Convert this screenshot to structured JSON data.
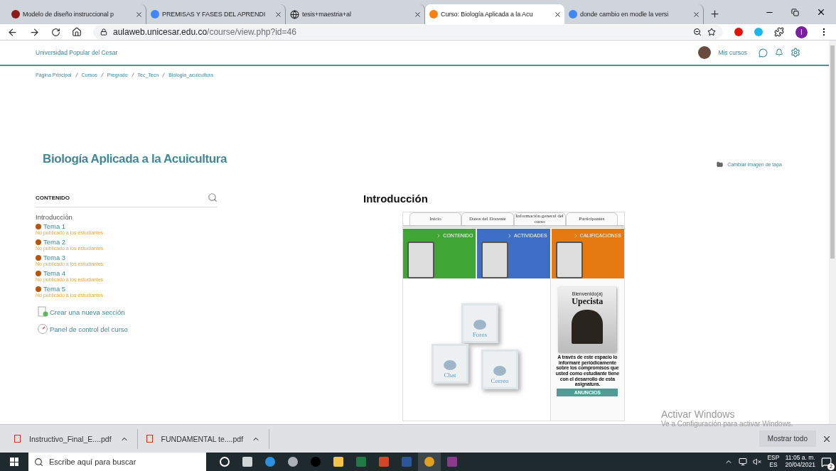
{
  "browser": {
    "tabs": [
      {
        "title": "Modelo de diseño instruccional p",
        "selected": false,
        "kind": "doc"
      },
      {
        "title": "PREMISAS Y FASES DEL APRENDI",
        "selected": false,
        "kind": "google"
      },
      {
        "title": "tesis+maestria+al",
        "selected": false,
        "kind": "globe"
      },
      {
        "title": "Curso: Biología Aplicada a la Acu",
        "selected": true,
        "kind": "moodle"
      },
      {
        "title": "donde cambio en modle la versi",
        "selected": false,
        "kind": "google"
      }
    ],
    "url": {
      "host": "aulaweb.unicesar.edu.co",
      "path": "/course/view.php?id=46"
    },
    "profile_initial": "I"
  },
  "page": {
    "site_name": "Universidad Popular del Cesar",
    "user_menu": "Mis cursos",
    "breadcrumbs": [
      "Página Principal",
      "Cursos",
      "Pregrado",
      "Tec_Tecn",
      "Biologia_acuicultura"
    ],
    "course_title": "Biología Aplicada a la Acuicultura",
    "cover_link": "Cambiar imagen de tapa",
    "sidebar": {
      "heading": "CONTENIDO",
      "items": [
        {
          "title": "Introducción",
          "hidden": false
        },
        {
          "title": "Tema 1",
          "hidden": true,
          "note": "No publicado a los estudiantes"
        },
        {
          "title": "Tema 2",
          "hidden": true,
          "note": "No publicado a los estudiantes"
        },
        {
          "title": "Tema 3",
          "hidden": true,
          "note": "No publicado a los estudiantes"
        },
        {
          "title": "Tema 4",
          "hidden": true,
          "note": "No publicado a los estudiantes"
        },
        {
          "title": "Tema 5",
          "hidden": true,
          "note": "No publicado a los estudiantes"
        }
      ],
      "actions": [
        {
          "label": "Crear una nueva sección",
          "kind": "add"
        },
        {
          "label": "Panel de control del curso",
          "kind": "dashboard"
        }
      ]
    },
    "section": {
      "title": "Introducción",
      "banner": {
        "tabs": [
          "Inicio",
          "Datos del Docente",
          "Información general del curso",
          "Participantes"
        ],
        "tiles": [
          {
            "label": "CONTENIDO",
            "color": "#3fa535"
          },
          {
            "label": "ACTIVIDADES",
            "color": "#3d6fc6"
          },
          {
            "label": "CALIFICACIONES",
            "color": "#e67a12"
          }
        ],
        "tools": [
          "Foros",
          "Chat",
          "Correo"
        ],
        "poster": {
          "greeting": "Bienvenido(a)",
          "headline": "Upecista",
          "text": "A través de este espacio lo informaré periódicamente sobre los compromisos que usted como estudiante tiene con el desarrollo de esta asignatura.",
          "button": "ANUNCIOS"
        }
      }
    }
  },
  "downloads": {
    "items": [
      "Instructivo_Final_E....pdf",
      "FUNDAMENTAL te....pdf"
    ],
    "show_all": "Mostrar todo"
  },
  "activation": {
    "title": "Activar Windows",
    "subtitle": "Ve a Configuración para activar Windows."
  },
  "taskbar": {
    "search_placeholder": "Escribe aquí para buscar",
    "apps": [
      {
        "kind": "cortana",
        "selected": false
      },
      {
        "kind": "taskview",
        "selected": false
      },
      {
        "kind": "edge",
        "selected": false
      },
      {
        "kind": "media",
        "selected": false
      },
      {
        "kind": "tiktok",
        "selected": false
      },
      {
        "kind": "folder",
        "selected": false
      },
      {
        "kind": "excel",
        "selected": false
      },
      {
        "kind": "powerpoint",
        "selected": false
      },
      {
        "kind": "word",
        "selected": false
      },
      {
        "kind": "chrome",
        "selected": true
      },
      {
        "kind": "archive",
        "selected": false
      }
    ],
    "tray": {
      "input_language": "ESP",
      "keyboard": "ES",
      "time": "11:05 a. m.",
      "date": "20/04/2021",
      "notifications": "2"
    }
  }
}
